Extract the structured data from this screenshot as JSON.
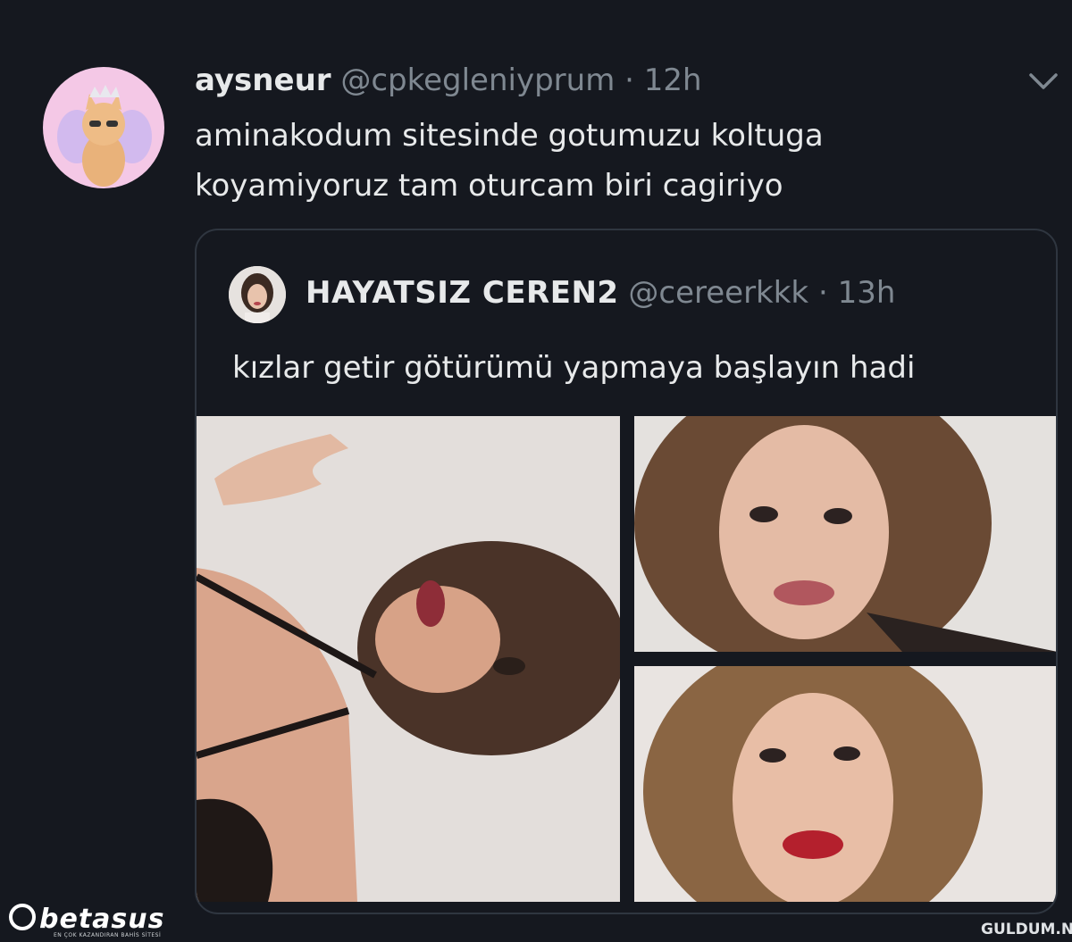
{
  "tweet": {
    "display_name": "aysneur",
    "handle": "@cpkegleniyprum",
    "separator": "·",
    "time": "12h",
    "text_line1": "aminakodum sitesinde gotumuzu koltuga",
    "text_line2": "koyamiyoruz tam oturcam biri cagiriyo"
  },
  "quoted_tweet": {
    "display_name": "HAYATSIZ CEREN2",
    "handle": "@cereerkkk",
    "separator": "·",
    "time": "13h",
    "text": "kızlar getir götürümü yapmaya başlayın hadi"
  },
  "watermarks": {
    "left_brand": "betasus",
    "left_tagline": "EN ÇOK KAZANDIRAN BAHİS SİTESİ",
    "right": "GULDUM.NET"
  },
  "icons": {
    "menu": "chevron-down-icon"
  },
  "colors": {
    "background": "#15181f",
    "text": "#e7e9ea",
    "muted": "#7f8891",
    "border": "#2f3640"
  }
}
